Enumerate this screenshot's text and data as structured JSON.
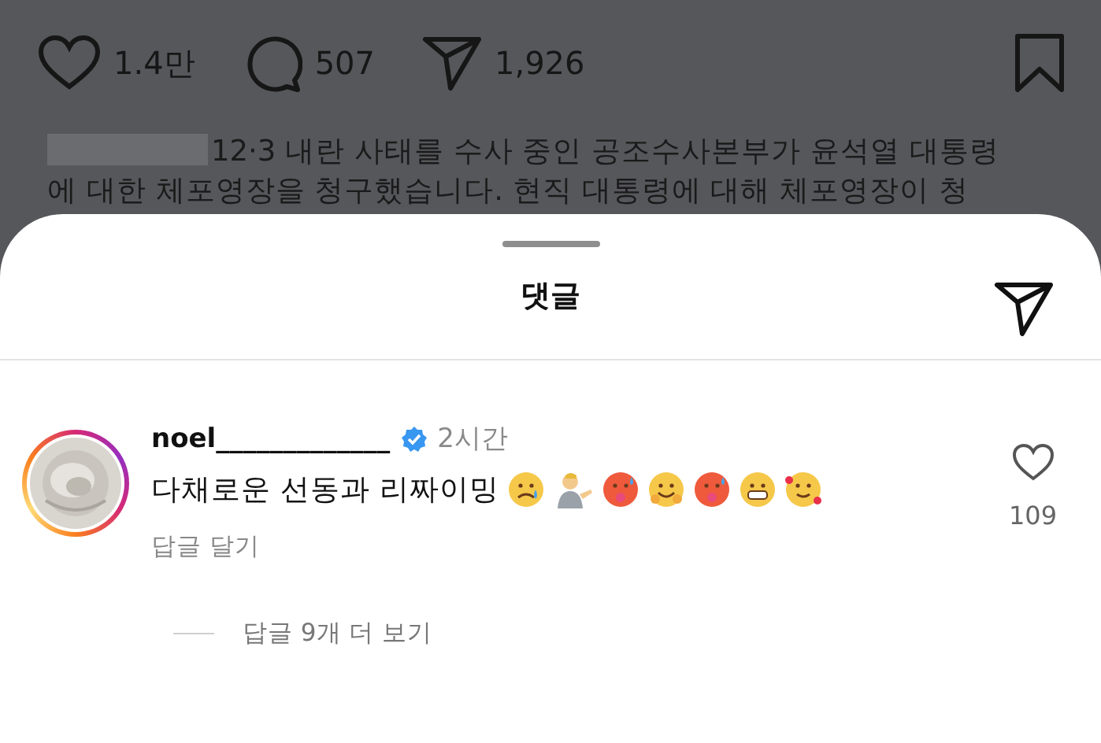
{
  "post_actions": {
    "likes": "1.4만",
    "comments": "507",
    "shares": "1,926"
  },
  "caption": {
    "redacted": true,
    "lines": [
      "12·3 내란 사태를 수사 중인 공조수사본부가 윤석열 대통령",
      "에 대한 체포영장을 청구했습니다. 현직 대통령에 대해 체포영장이 청"
    ]
  },
  "sheet": {
    "title": "댓글"
  },
  "comments": [
    {
      "username": "noel_____________",
      "verified": true,
      "time": "2시간",
      "text": "다채로운 선동과 리짜이밍",
      "emojis": [
        {
          "kind": "crying"
        },
        {
          "kind": "person"
        },
        {
          "kind": "hot"
        },
        {
          "kind": "hugging"
        },
        {
          "kind": "hot"
        },
        {
          "kind": "grimacing"
        },
        {
          "kind": "hearts"
        }
      ],
      "reply_label": "답글 달기",
      "like_count": "109",
      "liked": false,
      "more_replies": "답글 9개 더 보기"
    }
  ]
}
